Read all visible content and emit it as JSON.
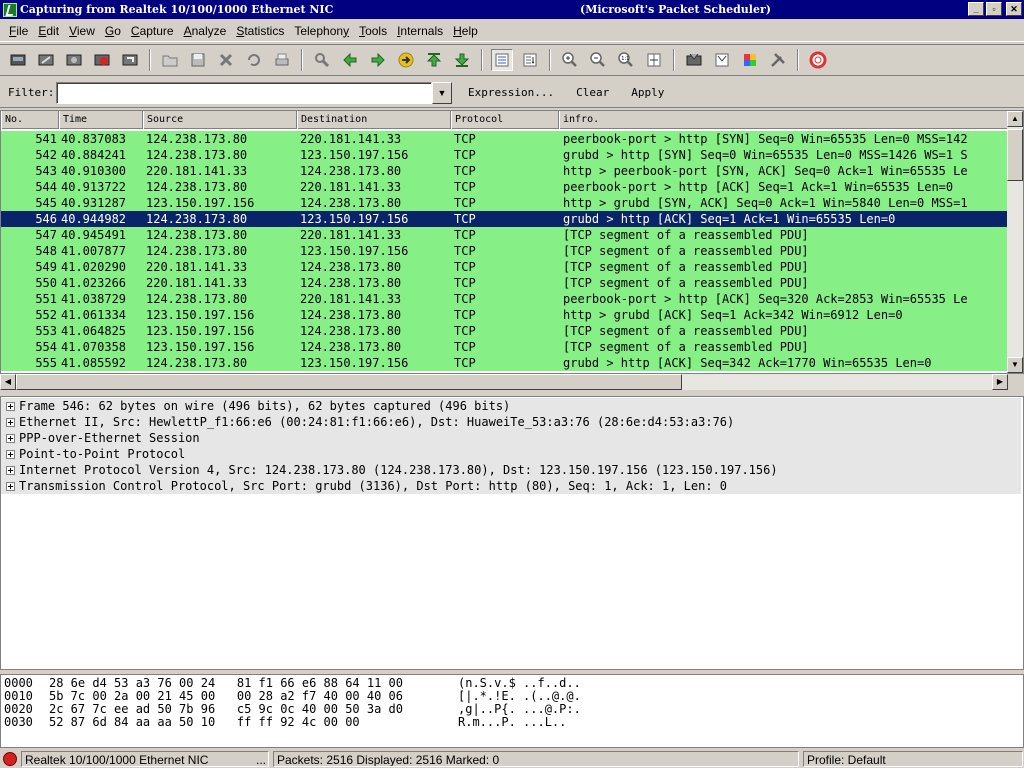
{
  "window": {
    "title": "Capturing from Realtek 10/100/1000 Ethernet NIC",
    "subtitle": "(Microsoft's Packet Scheduler)",
    "buttons": [
      "_",
      "▫",
      "✕"
    ]
  },
  "menu": [
    {
      "label": "File",
      "accel": "F"
    },
    {
      "label": "Edit",
      "accel": "E"
    },
    {
      "label": "View",
      "accel": "V"
    },
    {
      "label": "Go",
      "accel": "G"
    },
    {
      "label": "Capture",
      "accel": "C"
    },
    {
      "label": "Analyze",
      "accel": "A"
    },
    {
      "label": "Statistics",
      "accel": "S"
    },
    {
      "label": "Telephony",
      "accel": "y"
    },
    {
      "label": "Tools",
      "accel": "T"
    },
    {
      "label": "Internals",
      "accel": "I"
    },
    {
      "label": "Help",
      "accel": "H"
    }
  ],
  "toolbar": {
    "icons": [
      "interfaces-icon",
      "options-icon",
      "start-icon",
      "stop-icon",
      "restart-icon",
      "open-icon",
      "save-icon",
      "close-icon",
      "reload-icon",
      "print-icon",
      "find-icon",
      "back-icon",
      "forward-icon",
      "goto-icon",
      "first-icon",
      "last-icon",
      "colorize-icon",
      "autoscroll-icon",
      "zoom-in-icon",
      "zoom-out-icon",
      "zoom-normal-icon",
      "resize-columns-icon",
      "capture-filters-icon",
      "display-filters-icon",
      "coloring-rules-icon",
      "preferences-icon",
      "help-icon"
    ]
  },
  "filter": {
    "label": "Filter:",
    "value": "",
    "expression": "Expression...",
    "clear": "Clear",
    "apply": "Apply"
  },
  "columns": {
    "no": "No.",
    "time": "Time",
    "source": "Source",
    "destination": "Destination",
    "protocol": "Protocol",
    "info": "infro."
  },
  "packets": [
    {
      "no": "541",
      "time": "40.837083",
      "src": "124.238.173.80",
      "dst": "220.181.141.33",
      "proto": "TCP",
      "info": "peerbook-port > http [SYN] Seq=0 Win=65535 Len=0 MSS=142"
    },
    {
      "no": "542",
      "time": "40.884241",
      "src": "124.238.173.80",
      "dst": "123.150.197.156",
      "proto": "TCP",
      "info": "grubd > http [SYN] Seq=0 Win=65535 Len=0 MSS=1426 WS=1 S"
    },
    {
      "no": "543",
      "time": "40.910300",
      "src": "220.181.141.33",
      "dst": "124.238.173.80",
      "proto": "TCP",
      "info": "http > peerbook-port [SYN, ACK] Seq=0 Ack=1 Win=65535 Le"
    },
    {
      "no": "544",
      "time": "40.913722",
      "src": "124.238.173.80",
      "dst": "220.181.141.33",
      "proto": "TCP",
      "info": "peerbook-port > http [ACK] Seq=1 Ack=1 Win=65535 Len=0"
    },
    {
      "no": "545",
      "time": "40.931287",
      "src": "123.150.197.156",
      "dst": "124.238.173.80",
      "proto": "TCP",
      "info": "http > grubd [SYN, ACK] Seq=0 Ack=1 Win=5840 Len=0 MSS=1"
    },
    {
      "no": "546",
      "time": "40.944982",
      "src": "124.238.173.80",
      "dst": "123.150.197.156",
      "proto": "TCP",
      "info": "grubd > http [ACK] Seq=1 Ack=1 Win=65535 Len=0",
      "selected": true
    },
    {
      "no": "547",
      "time": "40.945491",
      "src": "124.238.173.80",
      "dst": "220.181.141.33",
      "proto": "TCP",
      "info": "[TCP segment of a reassembled PDU]"
    },
    {
      "no": "548",
      "time": "41.007877",
      "src": "124.238.173.80",
      "dst": "123.150.197.156",
      "proto": "TCP",
      "info": "[TCP segment of a reassembled PDU]"
    },
    {
      "no": "549",
      "time": "41.020290",
      "src": "220.181.141.33",
      "dst": "124.238.173.80",
      "proto": "TCP",
      "info": "[TCP segment of a reassembled PDU]"
    },
    {
      "no": "550",
      "time": "41.023266",
      "src": "220.181.141.33",
      "dst": "124.238.173.80",
      "proto": "TCP",
      "info": "[TCP segment of a reassembled PDU]"
    },
    {
      "no": "551",
      "time": "41.038729",
      "src": "124.238.173.80",
      "dst": "220.181.141.33",
      "proto": "TCP",
      "info": "peerbook-port > http [ACK] Seq=320 Ack=2853 Win=65535 Le"
    },
    {
      "no": "552",
      "time": "41.061334",
      "src": "123.150.197.156",
      "dst": "124.238.173.80",
      "proto": "TCP",
      "info": "http > grubd [ACK] Seq=1 Ack=342 Win=6912 Len=0"
    },
    {
      "no": "553",
      "time": "41.064825",
      "src": "123.150.197.156",
      "dst": "124.238.173.80",
      "proto": "TCP",
      "info": "[TCP segment of a reassembled PDU]"
    },
    {
      "no": "554",
      "time": "41.070358",
      "src": "123.150.197.156",
      "dst": "124.238.173.80",
      "proto": "TCP",
      "info": "[TCP segment of a reassembled PDU]"
    },
    {
      "no": "555",
      "time": "41.085592",
      "src": "124.238.173.80",
      "dst": "123.150.197.156",
      "proto": "TCP",
      "info": "grubd > http [ACK] Seq=342 Ack=1770 Win=65535 Len=0"
    }
  ],
  "details": [
    "Frame 546: 62 bytes on wire (496 bits), 62 bytes captured (496 bits)",
    "Ethernet II, Src: HewlettP_f1:66:e6 (00:24:81:f1:66:e6), Dst: HuaweiTe_53:a3:76 (28:6e:d4:53:a3:76)",
    "PPP-over-Ethernet Session",
    "Point-to-Point Protocol",
    "Internet Protocol Version 4, Src: 124.238.173.80 (124.238.173.80), Dst: 123.150.197.156 (123.150.197.156)",
    "Transmission Control Protocol, Src Port: grubd (3136), Dst Port: http (80), Seq: 1, Ack: 1, Len: 0"
  ],
  "hex": [
    {
      "offset": "0000",
      "bytes": "28 6e d4 53 a3 76 00 24   81 f1 66 e6 88 64 11 00",
      "ascii": "(n.S.v.$ ..f..d.."
    },
    {
      "offset": "0010",
      "bytes": "5b 7c 00 2a 00 21 45 00   00 28 a2 f7 40 00 40 06",
      "ascii": "[|.*.!E. .(..@.@."
    },
    {
      "offset": "0020",
      "bytes": "2c 67 7c ee ad 50 7b 96   c5 9c 0c 40 00 50 3a d0",
      "ascii": ",g|..P{. ...@.P:."
    },
    {
      "offset": "0030",
      "bytes": "52 87 6d 84 aa aa 50 10   ff ff 92 4c 00 00",
      "ascii": "R.m...P. ...L.."
    }
  ],
  "status": {
    "interface": "Realtek 10/100/1000 Ethernet NIC",
    "more": "...",
    "packets": "Packets: 2516 Displayed: 2516 Marked: 0",
    "profile": "Profile: Default"
  },
  "colors": {
    "row_bg": "#86f087",
    "selected_bg": "#0a246a",
    "titlebar": "#000080"
  }
}
